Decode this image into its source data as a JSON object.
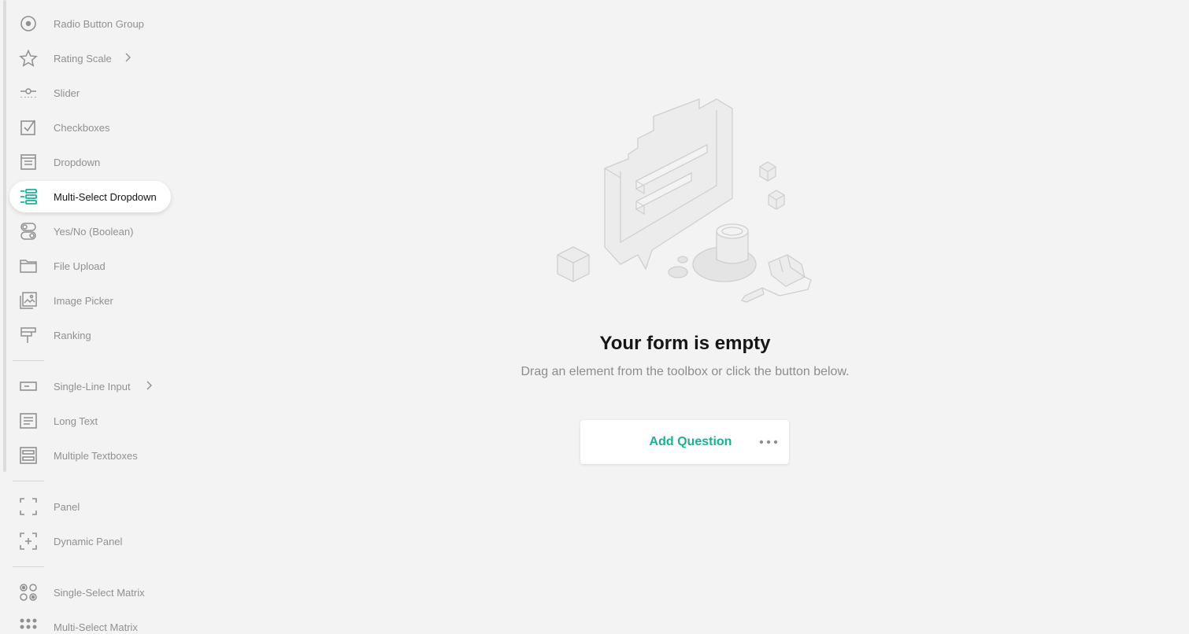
{
  "toolbox": {
    "groups": [
      {
        "items": [
          {
            "label": "Radio Button Group",
            "icon": "radio-button-icon"
          },
          {
            "label": "Rating Scale",
            "icon": "star-icon",
            "has_submenu": true
          },
          {
            "label": "Slider",
            "icon": "slider-icon"
          },
          {
            "label": "Checkboxes",
            "icon": "checkbox-icon"
          },
          {
            "label": "Dropdown",
            "icon": "dropdown-icon"
          },
          {
            "label": "Multi-Select Dropdown",
            "icon": "multi-select-dropdown-icon",
            "active": true
          },
          {
            "label": "Yes/No (Boolean)",
            "icon": "boolean-toggle-icon"
          },
          {
            "label": "File Upload",
            "icon": "folder-icon"
          },
          {
            "label": "Image Picker",
            "icon": "image-picker-icon"
          },
          {
            "label": "Ranking",
            "icon": "ranking-icon"
          }
        ]
      },
      {
        "items": [
          {
            "label": "Single-Line Input",
            "icon": "single-line-input-icon",
            "has_submenu": true
          },
          {
            "label": "Long Text",
            "icon": "long-text-icon"
          },
          {
            "label": "Multiple Textboxes",
            "icon": "multiple-textboxes-icon"
          }
        ]
      },
      {
        "items": [
          {
            "label": "Panel",
            "icon": "panel-icon"
          },
          {
            "label": "Dynamic Panel",
            "icon": "dynamic-panel-icon"
          }
        ]
      },
      {
        "items": [
          {
            "label": "Single-Select Matrix",
            "icon": "single-select-matrix-icon"
          },
          {
            "label": "Multi-Select Matrix",
            "icon": "multi-select-matrix-icon"
          }
        ]
      }
    ]
  },
  "empty_state": {
    "title": "Your form is empty",
    "subtitle": "Drag an element from the toolbox or click the button below.",
    "add_question_label": "Add Question",
    "more_icon": "more-dots-icon",
    "illustration": "empty-form-illustration"
  },
  "colors": {
    "accent": "#19b394",
    "background": "#f3f3f3",
    "text_primary": "#161616",
    "text_muted": "#909090"
  }
}
